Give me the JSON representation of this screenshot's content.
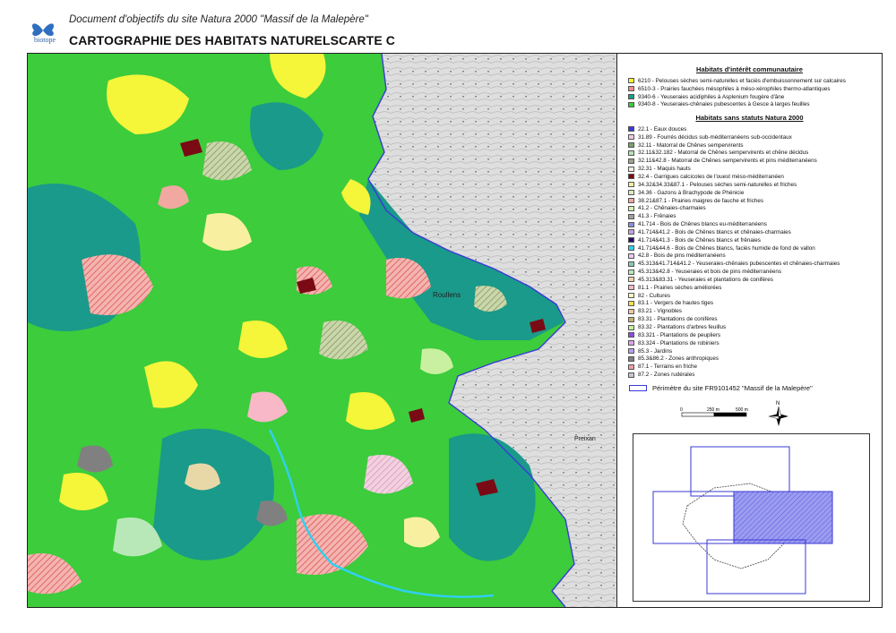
{
  "header": {
    "logo_text": "biotope",
    "subtitle": "Document d'objectifs du site Natura 2000 \"Massif de la Malepère\"",
    "title": "CARTOGRAPHIE DES HABITATS NATURELSCARTE C"
  },
  "map": {
    "place_labels": [
      "Roullens",
      "Preixan"
    ]
  },
  "legend": {
    "heading_community": "Habitats d'intérêt communautaire",
    "community_items": [
      {
        "label": "6210 - Pelouses sèches semi-naturelles et faciès d'embuissonnement sur calcaires",
        "color": "#f5f53a"
      },
      {
        "label": "6510-3 - Prairies fauchées mésophiles à méso-xérophiles thermo-atlantiques",
        "color": "#f08c8c"
      },
      {
        "label": "9340-6 - Yeuseraies acidiphiles à Asplenium fougère d'âne",
        "color": "#1a9a8a"
      },
      {
        "label": "9340-8 - Yeuseraies-chênaies pubescentes à Gesce à larges feuilles",
        "color": "#3ccc3c"
      }
    ],
    "heading_other": "Habitats sans statuts Natura 2000",
    "other_items": [
      {
        "label": "22.1 - Eaux douces",
        "color": "#3a3ad6"
      },
      {
        "label": "31.89 - Fourrés décidus sub-méditerranéens sub-occidentaux",
        "color": "#f2c8d8"
      },
      {
        "label": "32.11 - Matorral de Chênes sempervirents",
        "color": "#7aa06a"
      },
      {
        "label": "32.11&32.182 - Matorral de Chênes sempervirents et chêne décidus",
        "color": "#b8e0b0"
      },
      {
        "label": "32.11&42.8 - Matorral de Chênes sempervirents et pins méditerranéens",
        "color": "#a0a08c"
      },
      {
        "label": "32.31 - Maquis hauts",
        "color": "#f0f0e0"
      },
      {
        "label": "32.4 - Garrigues calcicoles de l'ouest méso-méditerranéen",
        "color": "#7a0a14"
      },
      {
        "label": "34.32&34.33&87.1 - Pelouses sèches semi-naturelles et friches",
        "color": "#f8f0a0"
      },
      {
        "label": "34.36 - Gazons à Brachypode de Phénicie",
        "color": "#d8ecc0"
      },
      {
        "label": "38.21&87.1 - Prairies maigres de fauche et friches",
        "color": "#f0a8a0"
      },
      {
        "label": "41.2 - Chênaies-charmaies",
        "color": "#d8f0b0"
      },
      {
        "label": "41.3 - Frênaies",
        "color": "#a0a0a0"
      },
      {
        "label": "41.714 - Bois de Chênes blancs eu-méditerranéens",
        "color": "#8c8cdc"
      },
      {
        "label": "41.714&41.2 - Bois de Chênes blancs et chênaies-charmaies",
        "color": "#c8a0e0"
      },
      {
        "label": "41.714&41.3 - Bois de Chênes blancs et frênaies",
        "color": "#2a0a6a"
      },
      {
        "label": "41.714&44.6 - Bois de Chênes blancs, faciès humide de fond de vallon",
        "color": "#30d0f0"
      },
      {
        "label": "42.8 - Bois de pins méditerranéens",
        "color": "#f0c8f0"
      },
      {
        "label": "45.313&41.714&41.2 - Yeuseraies-chênaies pubescentes et chênaies-charmaies",
        "color": "#8cc8b0"
      },
      {
        "label": "45.313&42.8 - Yeuseraies et bois de pins méditerranéens",
        "color": "#b8e8b8"
      },
      {
        "label": "45.313&83.31 - Yeuseraies et plantations de conifères",
        "color": "#e8d8a8"
      },
      {
        "label": "81.1 - Prairies sèches améliorées",
        "color": "#f8b8c8"
      },
      {
        "label": "82 - Cultures",
        "color": "#f8f8c0"
      },
      {
        "label": "83.1 - Vergers de hautes tiges",
        "color": "#f8e048"
      },
      {
        "label": "83.21 - Vignobles",
        "color": "#f0c8a0"
      },
      {
        "label": "83.31 - Plantations de conifères",
        "color": "#c8b070"
      },
      {
        "label": "83.32 - Plantations d'arbres feuillus",
        "color": "#c8f0a0"
      },
      {
        "label": "83.321 - Plantations de peupliers",
        "color": "#8c4ce0"
      },
      {
        "label": "83.324 - Plantations de robiniers",
        "color": "#e0a0f0"
      },
      {
        "label": "85.3 - Jardins",
        "color": "#b8a0f0"
      },
      {
        "label": "85.3&86.2 - Zones anthropiques",
        "color": "#808080"
      },
      {
        "label": "87.1 - Terrains en friche",
        "color": "#f0a0a0"
      },
      {
        "label": "87.2 - Zones rudérales",
        "color": "#c8c8c8"
      }
    ],
    "perimeter_label": "Périmètre du site FR9101452 \"Massif de la Malepère\"",
    "scale": {
      "t0": "0",
      "t1": "250 m",
      "t2": "500 m"
    },
    "north_label": "N"
  },
  "colors": {
    "perimeter": "#3a3ad6",
    "forest_green": "#3ccc3c",
    "dark_teal": "#1a9a8a",
    "yellow": "#f5f53a",
    "topo_grey": "#dcdcdc"
  }
}
